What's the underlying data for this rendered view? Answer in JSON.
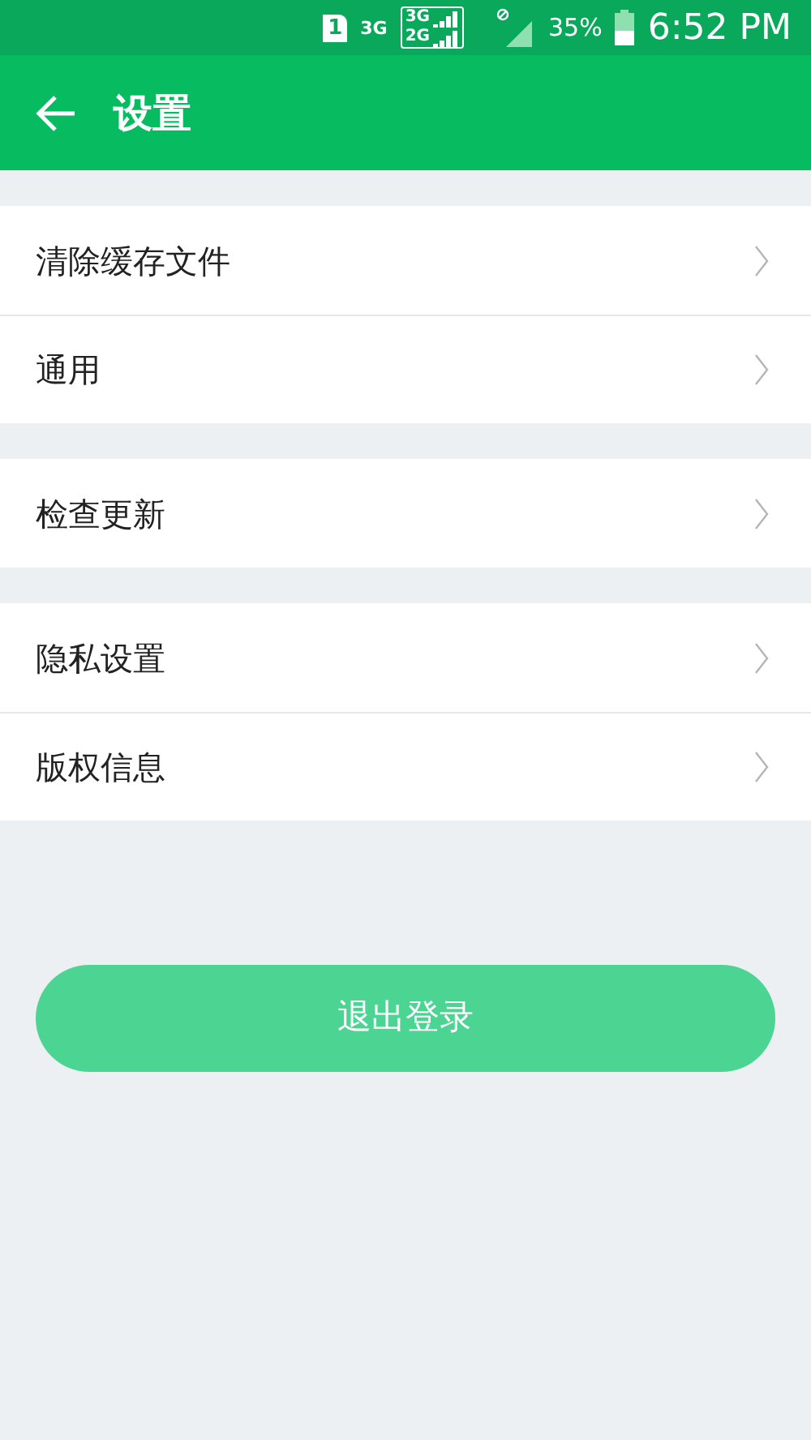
{
  "status_bar": {
    "sim": "1",
    "network": "3G",
    "sim_1_network": "3G",
    "sim_2_network": "2G",
    "battery": "35%",
    "time": "6:52 PM"
  },
  "header": {
    "title": "设置"
  },
  "groups": [
    {
      "items": [
        {
          "label": "清除缓存文件"
        },
        {
          "label": "通用"
        }
      ]
    },
    {
      "items": [
        {
          "label": "检查更新"
        }
      ]
    },
    {
      "items": [
        {
          "label": "隐私设置"
        },
        {
          "label": "版权信息"
        }
      ]
    }
  ],
  "logout_button": "退出登录"
}
